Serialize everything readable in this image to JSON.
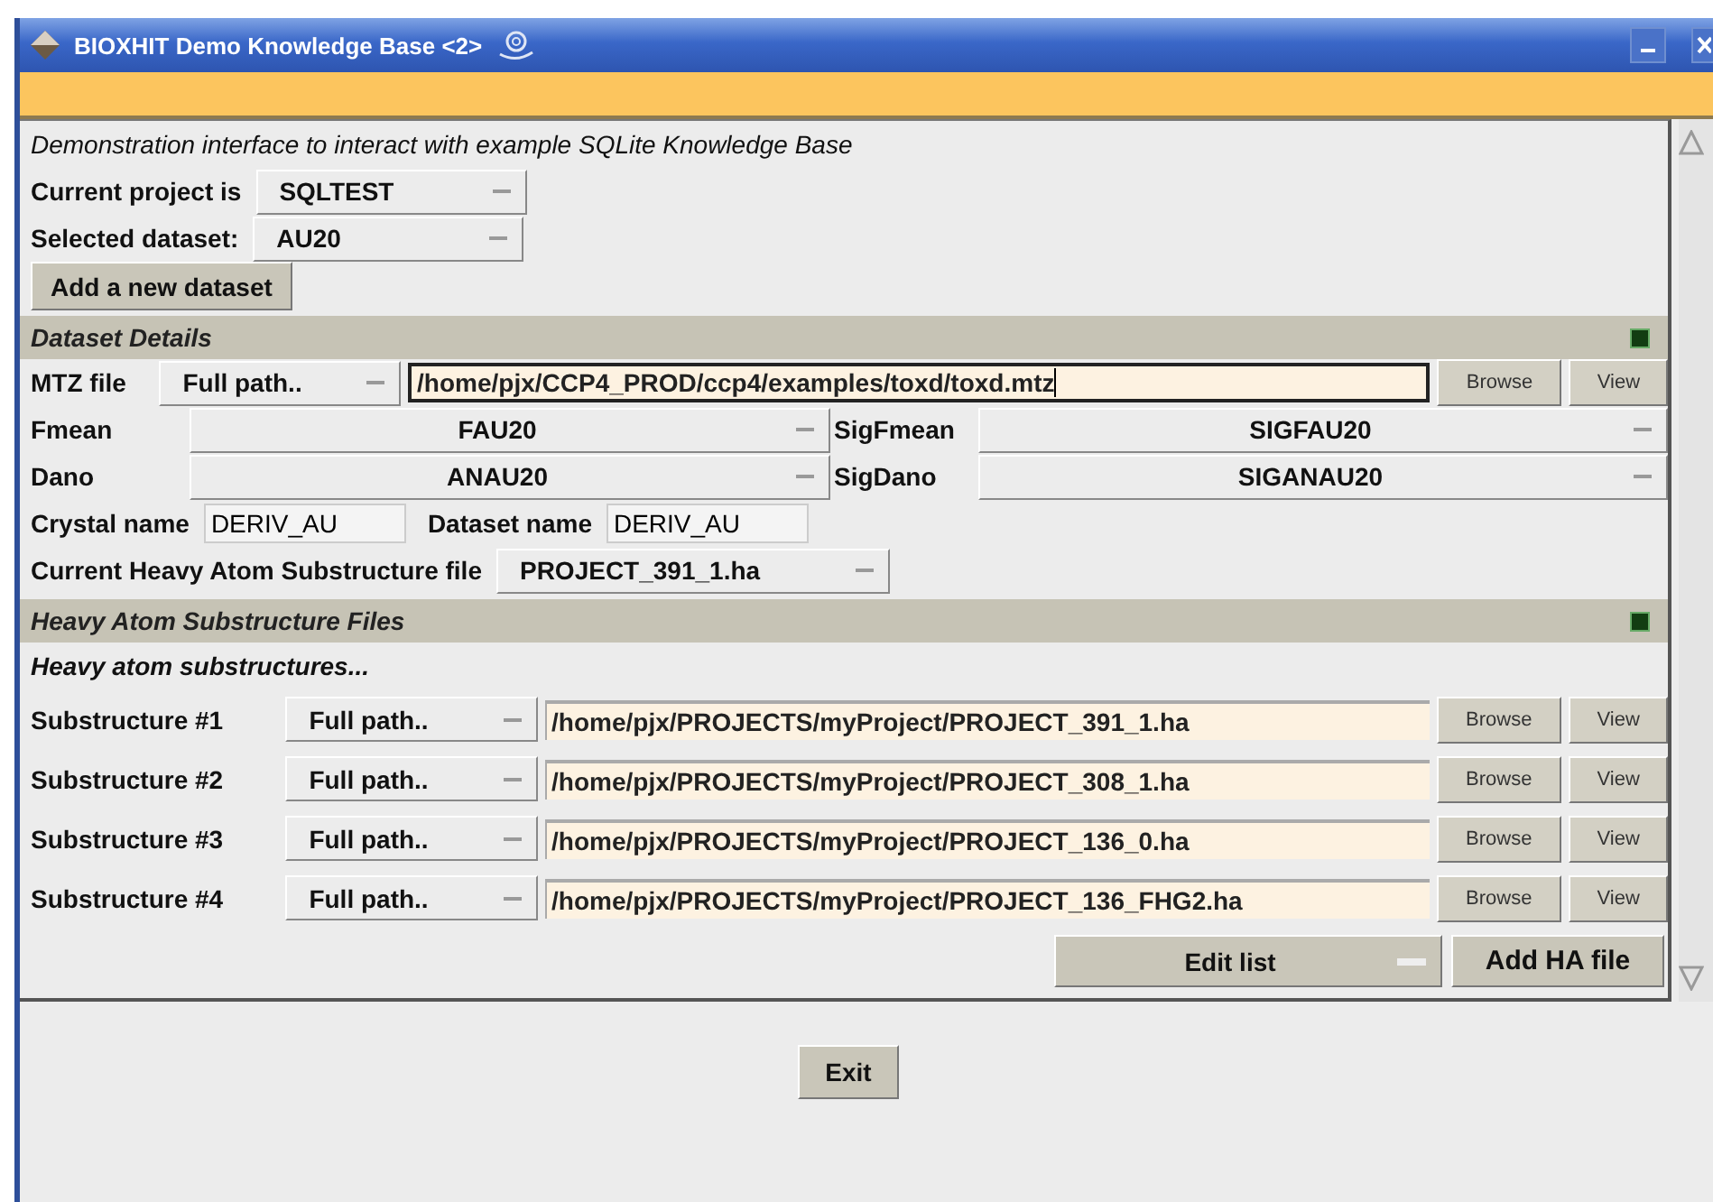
{
  "window": {
    "title": "BIOXHIT Demo Knowledge Base <2>"
  },
  "intro": "Demonstration interface to interact with example SQLite Knowledge Base",
  "project": {
    "label": "Current project is",
    "value": "SQLTEST"
  },
  "dataset": {
    "label": "Selected dataset:",
    "value": "AU20"
  },
  "add_dataset_button": "Add a new dataset",
  "dataset_details": {
    "title": "Dataset Details",
    "expanded": true,
    "mtz": {
      "label": "MTZ file",
      "mode": "Full path..",
      "value": "/home/pjx/CCP4_PROD/ccp4/examples/toxd/toxd.mtz",
      "browse": "Browse",
      "view": "View"
    },
    "columns": [
      {
        "label": "Fmean",
        "value": "FAU20",
        "sig_label": "SigFmean",
        "sig_value": "SIGFAU20"
      },
      {
        "label": "Dano",
        "value": "ANAU20",
        "sig_label": "SigDano",
        "sig_value": "SIGANAU20"
      }
    ],
    "crystal": {
      "label": "Crystal name",
      "value": "DERIV_AU"
    },
    "dataset_name": {
      "label": "Dataset name",
      "value": "DERIV_AU"
    },
    "ha_file": {
      "label": "Current Heavy Atom Substructure file",
      "value": "PROJECT_391_1.ha"
    }
  },
  "heavy_atoms": {
    "title": "Heavy Atom Substructure Files",
    "expanded": true,
    "subtitle": "Heavy atom substructures...",
    "substructures": [
      {
        "label": "Substructure #1",
        "mode": "Full path..",
        "value": "/home/pjx/PROJECTS/myProject/PROJECT_391_1.ha",
        "browse": "Browse",
        "view": "View"
      },
      {
        "label": "Substructure #2",
        "mode": "Full path..",
        "value": "/home/pjx/PROJECTS/myProject/PROJECT_308_1.ha",
        "browse": "Browse",
        "view": "View"
      },
      {
        "label": "Substructure #3",
        "mode": "Full path..",
        "value": "/home/pjx/PROJECTS/myProject/PROJECT_136_0.ha",
        "browse": "Browse",
        "view": "View"
      },
      {
        "label": "Substructure #4",
        "mode": "Full path..",
        "value": "/home/pjx/PROJECTS/myProject/PROJECT_136_FHG2.ha",
        "browse": "Browse",
        "view": "View"
      }
    ],
    "edit_list": "Edit list",
    "add_button": "Add HA file"
  },
  "exit_button": "Exit"
}
